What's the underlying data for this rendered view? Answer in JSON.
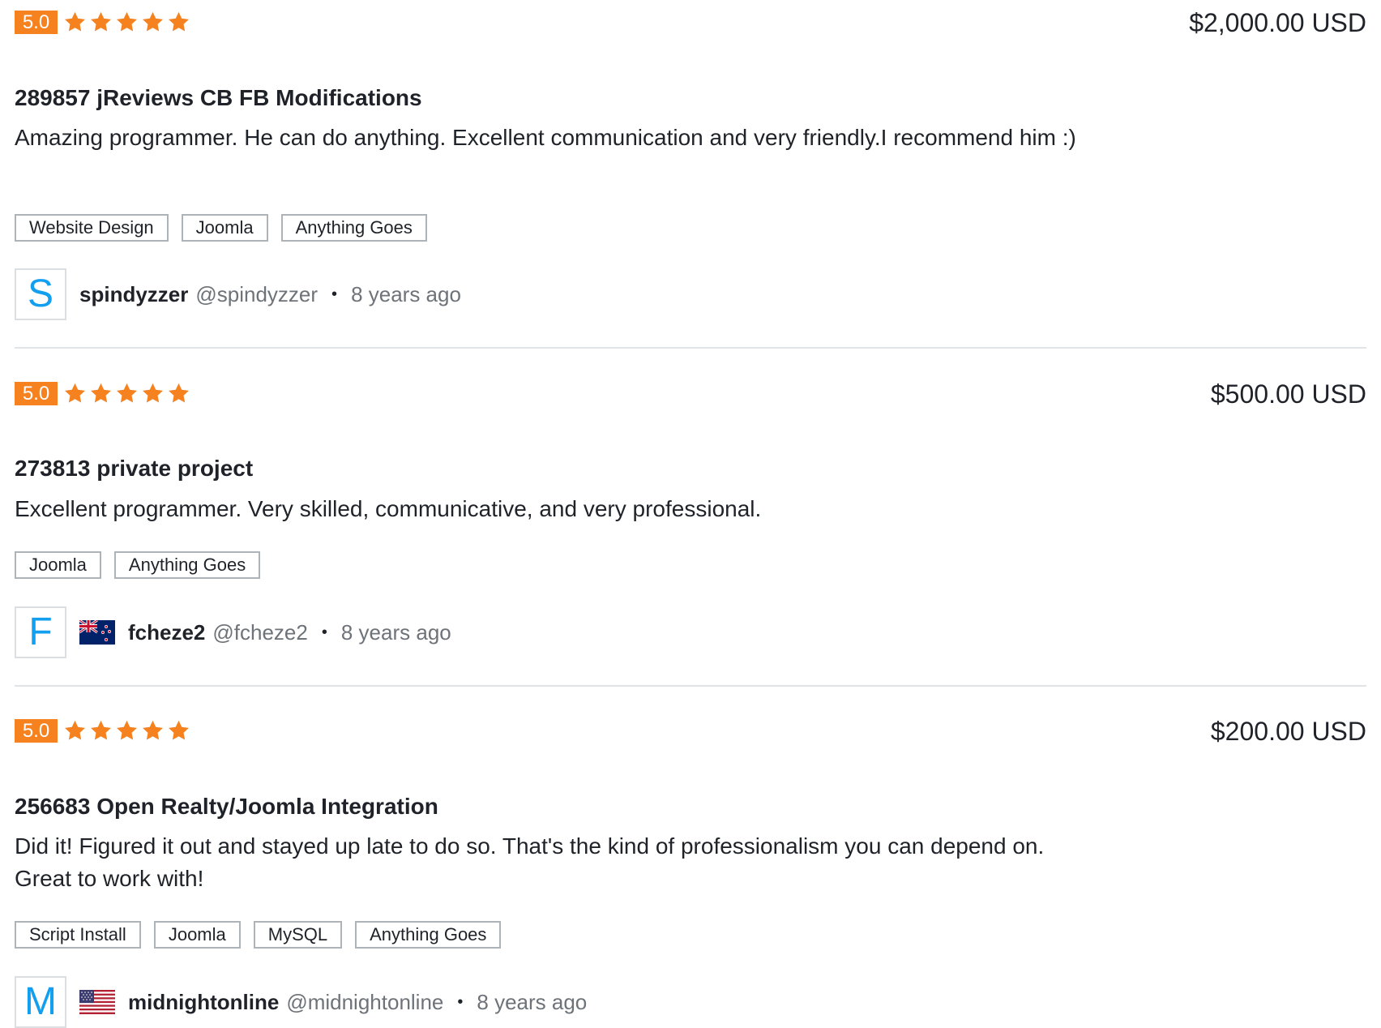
{
  "reviews": [
    {
      "rating": "5.0",
      "stars": 5,
      "amount": "$2,000.00 USD",
      "title": "289857 jReviews CB FB Modifications",
      "text": "Amazing programmer. He can do anything. Excellent communication and very friendly.I recommend him :)",
      "tags": [
        "Website Design",
        "Joomla",
        "Anything Goes"
      ],
      "reviewer": {
        "initial": "S",
        "name": "spindyzzer",
        "handle": "@spindyzzer",
        "flag": null,
        "separator": "•",
        "time": "8 years ago"
      }
    },
    {
      "rating": "5.0",
      "stars": 5,
      "amount": "$500.00 USD",
      "title": "273813 private project",
      "text": "Excellent programmer. Very skilled, communicative, and very professional.",
      "tags": [
        "Joomla",
        "Anything Goes"
      ],
      "reviewer": {
        "initial": "F",
        "name": "fcheze2",
        "handle": "@fcheze2",
        "flag": "new-zealand-flag-icon",
        "separator": "•",
        "time": "8 years ago"
      }
    },
    {
      "rating": "5.0",
      "stars": 5,
      "amount": "$200.00 USD",
      "title": "256683 Open Realty/Joomla Integration",
      "text": "Did it! Figured it out and stayed up late to do so. That's the kind of professionalism you can depend on. Great to work with!",
      "tags": [
        "Script Install",
        "Joomla",
        "MySQL",
        "Anything Goes"
      ],
      "reviewer": {
        "initial": "M",
        "name": "midnightonline",
        "handle": "@midnightonline",
        "flag": "usa-flag-icon",
        "separator": "•",
        "time": "8 years ago"
      }
    }
  ],
  "colors": {
    "rating_accent": "#f6811f",
    "avatar_initial": "#139ff0",
    "text": "#1f2329",
    "muted_text": "#6d7379",
    "divider": "#e1e4e6"
  }
}
